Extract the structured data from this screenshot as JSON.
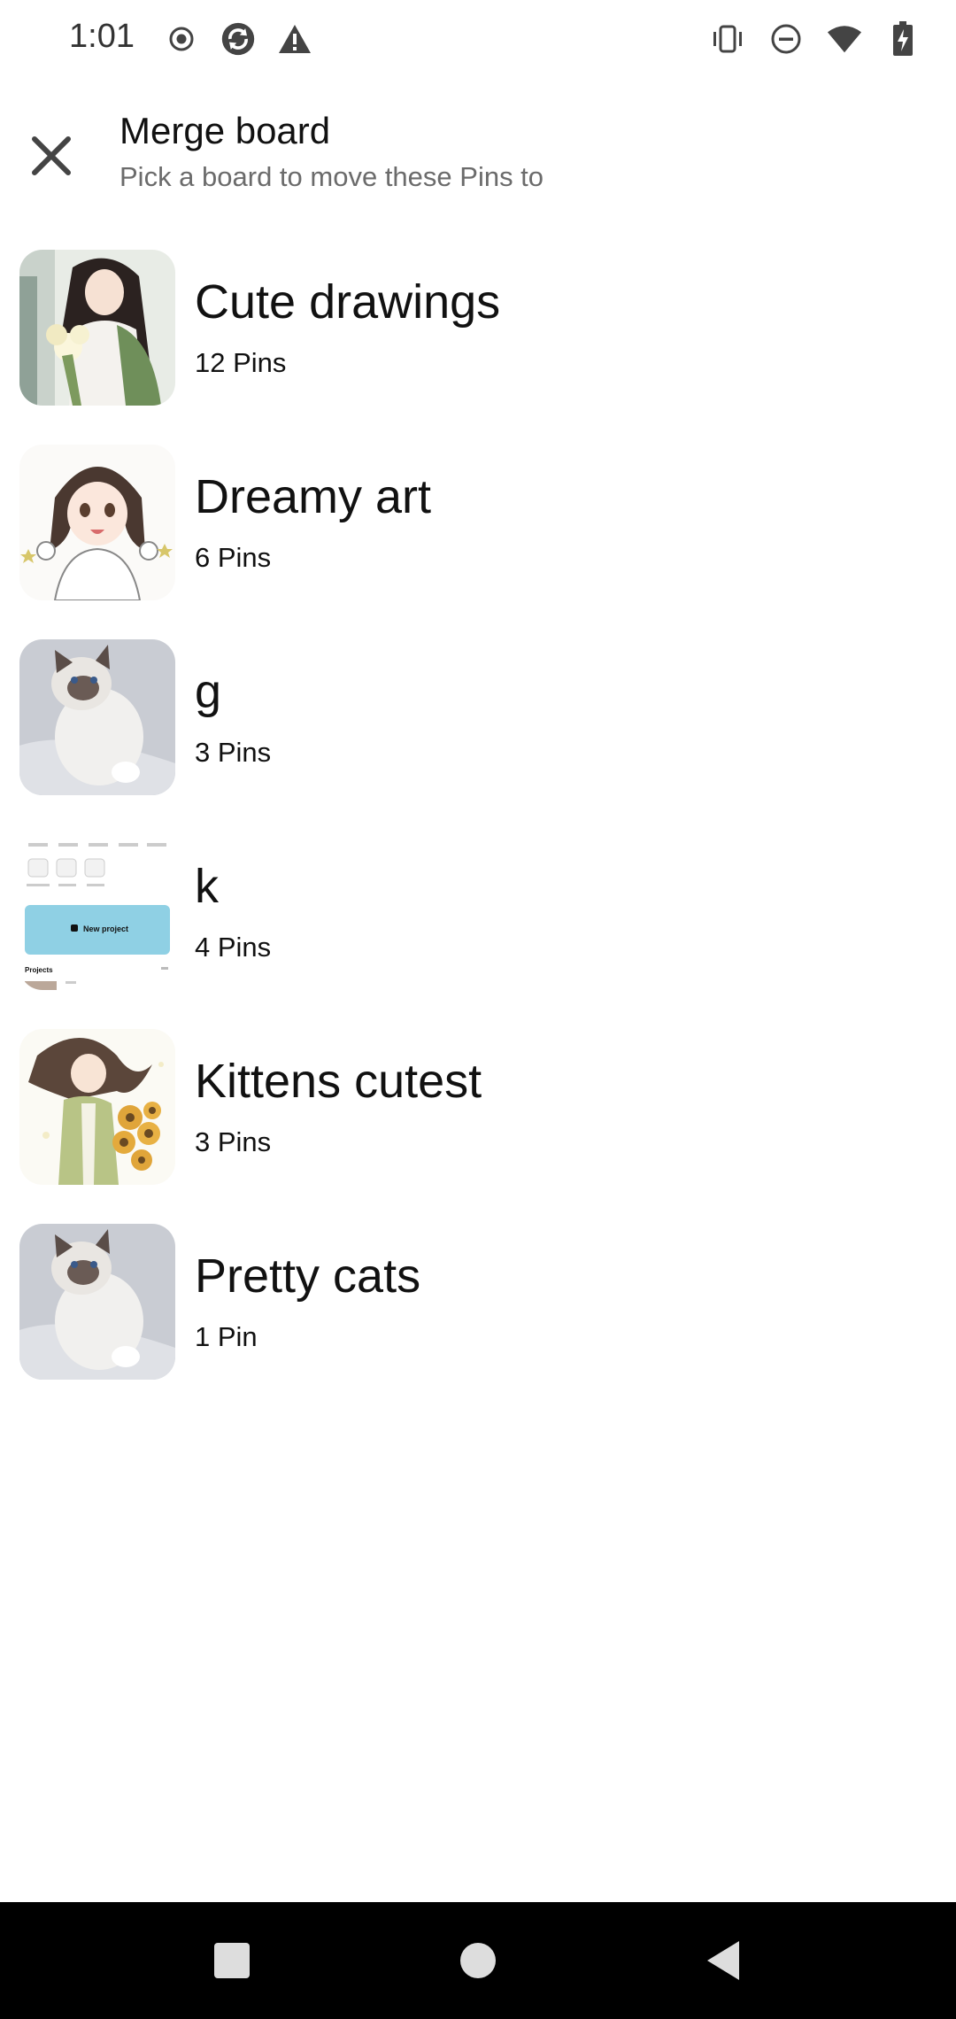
{
  "status_bar": {
    "time": "1:01",
    "left_icons": [
      "record-icon",
      "sync-icon",
      "warning-icon"
    ],
    "right_icons": [
      "vibrate-icon",
      "do-not-disturb-icon",
      "wifi-icon",
      "battery-charging-icon"
    ]
  },
  "header": {
    "title": "Merge board",
    "subtitle": "Pick a board to move these Pins to"
  },
  "boards": [
    {
      "name": "Cute drawings",
      "count": "12 Pins",
      "thumb": "anime-girl-bouquet"
    },
    {
      "name": "Dreamy art",
      "count": "6 Pins",
      "thumb": "anime-girl-cheering"
    },
    {
      "name": "g",
      "count": "3 Pins",
      "thumb": "ragdoll-cat"
    },
    {
      "name": "k",
      "count": "4 Pins",
      "thumb": "app-screenshot"
    },
    {
      "name": "Kittens cutest",
      "count": "3 Pins",
      "thumb": "anime-girl-sunflowers"
    },
    {
      "name": "Pretty cats",
      "count": "1 Pin",
      "thumb": "ragdoll-cat"
    }
  ],
  "thumb_screenshot": {
    "button_label": "New project",
    "section_label": "Projects"
  },
  "nav_bar": {
    "buttons": [
      "recents-button",
      "home-button",
      "back-button"
    ]
  },
  "colors": {
    "background": "#ffffff",
    "text_primary": "#111111",
    "text_secondary": "#6b6b6b",
    "nav_bar": "#000000"
  }
}
